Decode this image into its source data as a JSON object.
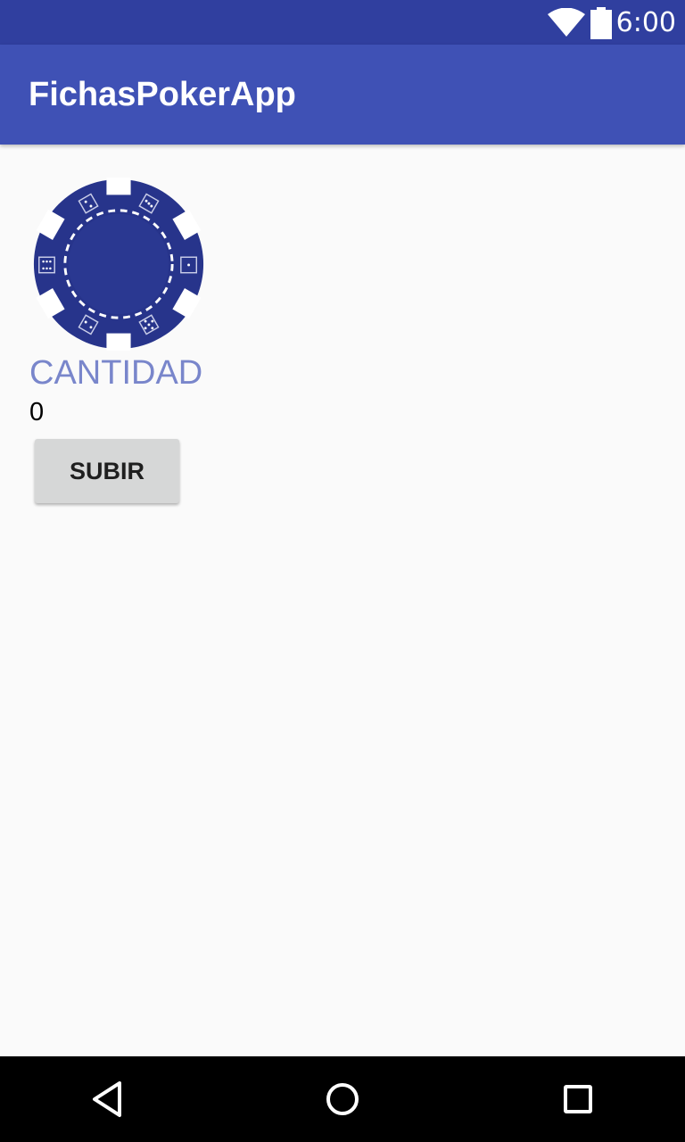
{
  "status_bar": {
    "time": "6:00",
    "icons": [
      "wifi-icon",
      "battery-icon"
    ]
  },
  "app_bar": {
    "title": "FichasPokerApp"
  },
  "main": {
    "chip_image": "poker-chip-icon",
    "quantity_label": "CANTIDAD",
    "quantity_value": "0",
    "raise_button_label": "SUBIR"
  },
  "nav_bar": {
    "icons": [
      "back-icon",
      "home-icon",
      "recents-icon"
    ]
  },
  "colors": {
    "primary": "#3f51b5",
    "primary_dark": "#303f9f",
    "accent_label": "#7986cb",
    "chip_blue": "#27348b",
    "button_bg": "#d6d7d7"
  }
}
